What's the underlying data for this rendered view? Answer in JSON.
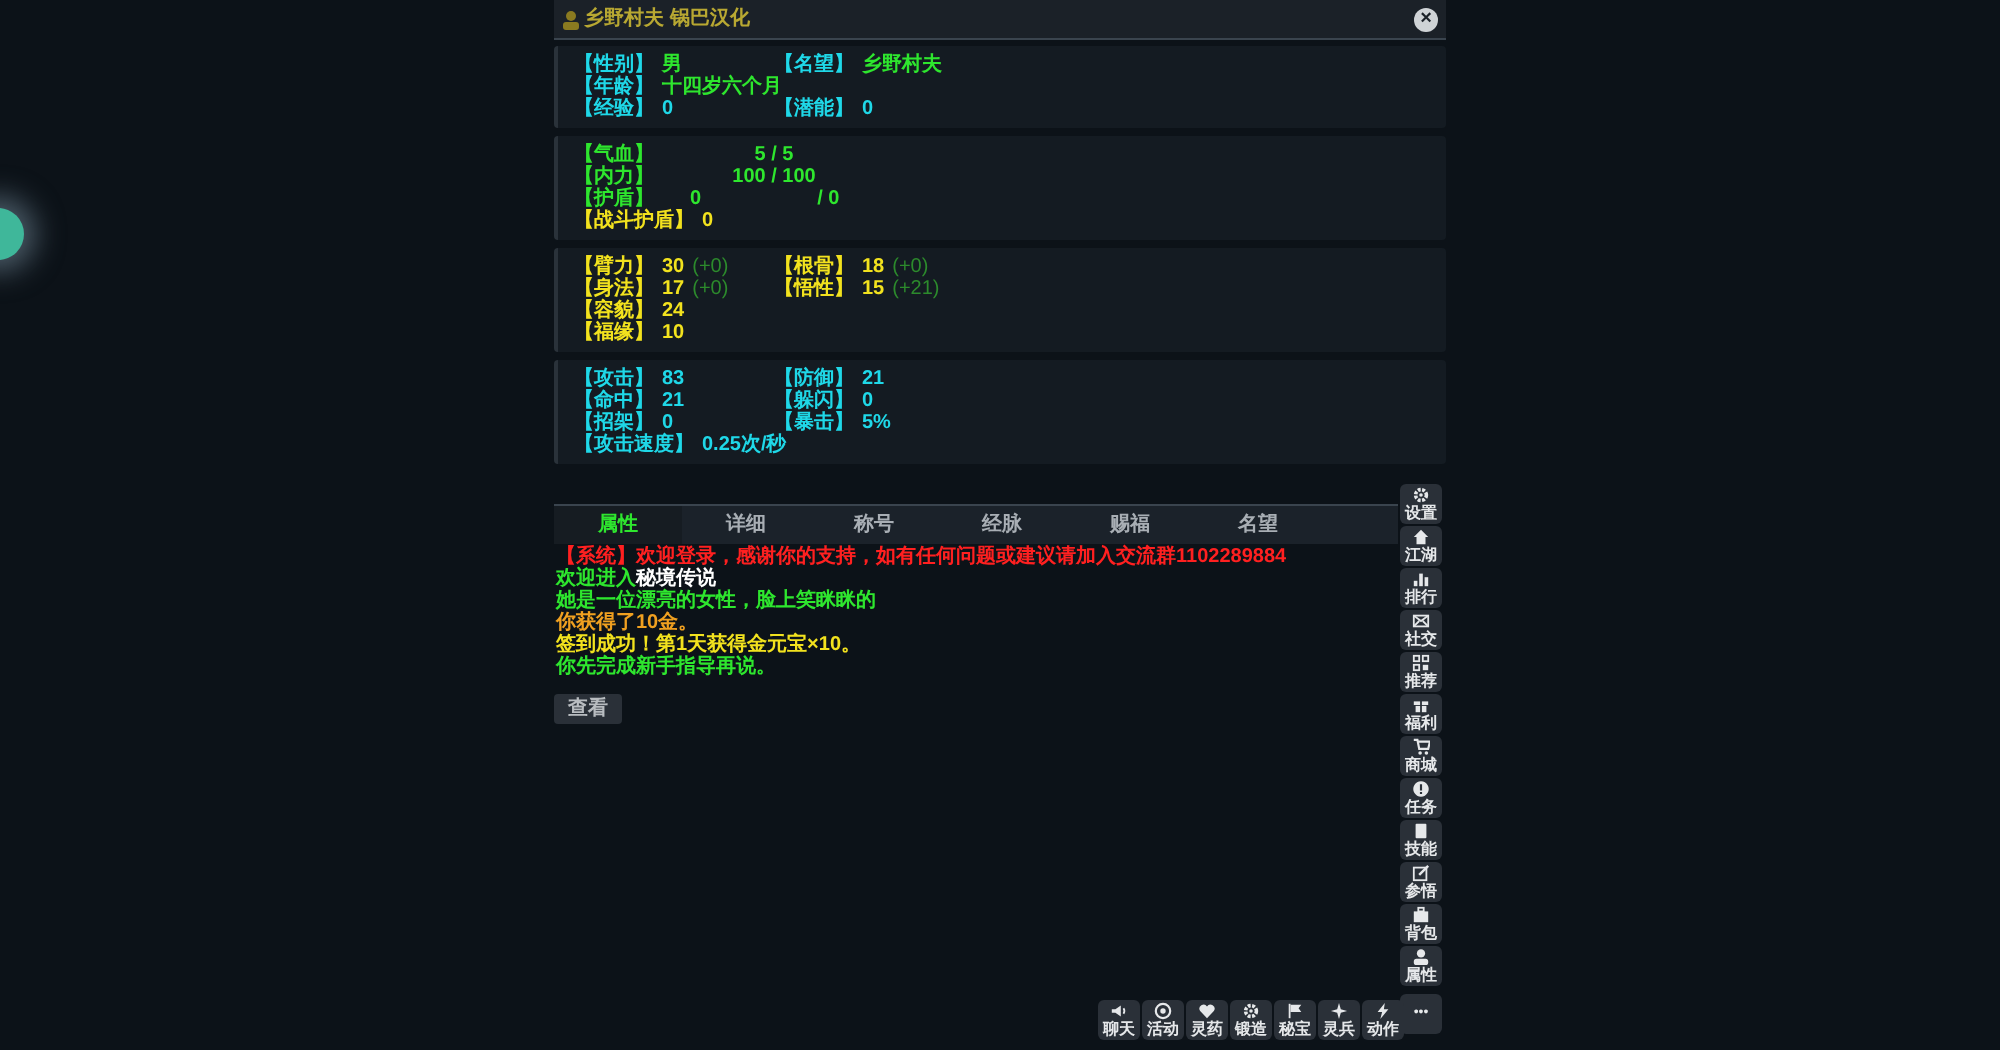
{
  "window": {
    "title": "乡野村夫 锅巴汉化",
    "close": "×"
  },
  "sections": [
    {
      "rows": [
        [
          {
            "label": "【性别】",
            "value": "男",
            "kind": "info"
          },
          {
            "label": "【名望】",
            "value": "乡野村夫",
            "kind": "info"
          }
        ],
        [
          {
            "label": "【年龄】",
            "value": "十四岁六个月",
            "kind": "info"
          }
        ],
        [
          {
            "label": "【经验】",
            "value": "0",
            "kind": "stat"
          },
          {
            "label": "【潜能】",
            "value": "0",
            "kind": "stat"
          }
        ]
      ]
    },
    {
      "kind": "pool",
      "rows": [
        [
          {
            "label": "【气血】",
            "value": "5 / 5",
            "kind": "vital"
          }
        ],
        [
          {
            "label": "【内力】",
            "value": "100 / 100",
            "kind": "vital"
          }
        ],
        [
          {
            "label": "【护盾】",
            "value": "0",
            "value_2": "/ 0",
            "kind": "vital"
          }
        ],
        [
          {
            "label": "【战斗护盾】",
            "value": "0",
            "kind": "attr"
          }
        ]
      ]
    },
    {
      "rows": [
        [
          {
            "label": "【臂力】",
            "value": "30",
            "bonus": "(+0)",
            "kind": "attr"
          },
          {
            "label": "【根骨】",
            "value": "18",
            "bonus": "(+0)",
            "kind": "attr"
          }
        ],
        [
          {
            "label": "【身法】",
            "value": "17",
            "bonus": "(+0)",
            "kind": "attr"
          },
          {
            "label": "【悟性】",
            "value": "15",
            "bonus": "(+21)",
            "kind": "attr"
          }
        ],
        [
          {
            "label": "【容貌】",
            "value": "24",
            "kind": "attr"
          }
        ],
        [
          {
            "label": "【福缘】",
            "value": "10",
            "kind": "attr"
          }
        ]
      ]
    },
    {
      "rows": [
        [
          {
            "label": "【攻击】",
            "value": "83",
            "kind": "stat"
          },
          {
            "label": "【防御】",
            "value": "21",
            "kind": "stat"
          }
        ],
        [
          {
            "label": "【命中】",
            "value": "21",
            "kind": "stat"
          },
          {
            "label": "【躲闪】",
            "value": "0",
            "kind": "stat"
          }
        ],
        [
          {
            "label": "【招架】",
            "value": "0",
            "kind": "stat"
          },
          {
            "label": "【暴击】",
            "value": "5%",
            "kind": "stat"
          }
        ],
        [
          {
            "label": "【攻击速度】",
            "value": "0.25次/秒",
            "kind": "stat"
          }
        ]
      ]
    }
  ],
  "tabs": [
    {
      "label": "属性",
      "selected": true
    },
    {
      "label": "详细",
      "selected": false
    },
    {
      "label": "称号",
      "selected": false
    },
    {
      "label": "经脉",
      "selected": false
    },
    {
      "label": "赐福",
      "selected": false
    },
    {
      "label": "名望",
      "selected": false
    }
  ],
  "messages": [
    [
      {
        "text": "【系统】欢迎登录，感谢你的支持，如有任何问题或建议请加入交流群1102289884",
        "kind": "system"
      }
    ],
    [
      {
        "text": "欢迎进入",
        "kind": "info"
      },
      {
        "text": "秘境传说",
        "kind": "highlight"
      }
    ],
    [
      {
        "text": "她是一位漂亮的女性，脸上笑眯眯的",
        "kind": "info"
      }
    ],
    [
      {
        "text": "你获得了10金。",
        "kind": "gain"
      }
    ],
    [
      {
        "text": "签到成功！第1天获得金元宝×10。",
        "kind": "reward"
      }
    ],
    [
      {
        "text": "你先完成新手指导再说。",
        "kind": "info"
      }
    ]
  ],
  "view_button": "查看",
  "side_menu": [
    "设置",
    "江湖",
    "排行",
    "社交",
    "推荐",
    "福利",
    "商城",
    "任务",
    "技能",
    "参悟",
    "背包",
    "属性"
  ],
  "bottom_menu": [
    "聊天",
    "活动",
    "灵药",
    "锻造",
    "秘宝",
    "灵兵",
    "动作"
  ],
  "more_button": "•••"
}
